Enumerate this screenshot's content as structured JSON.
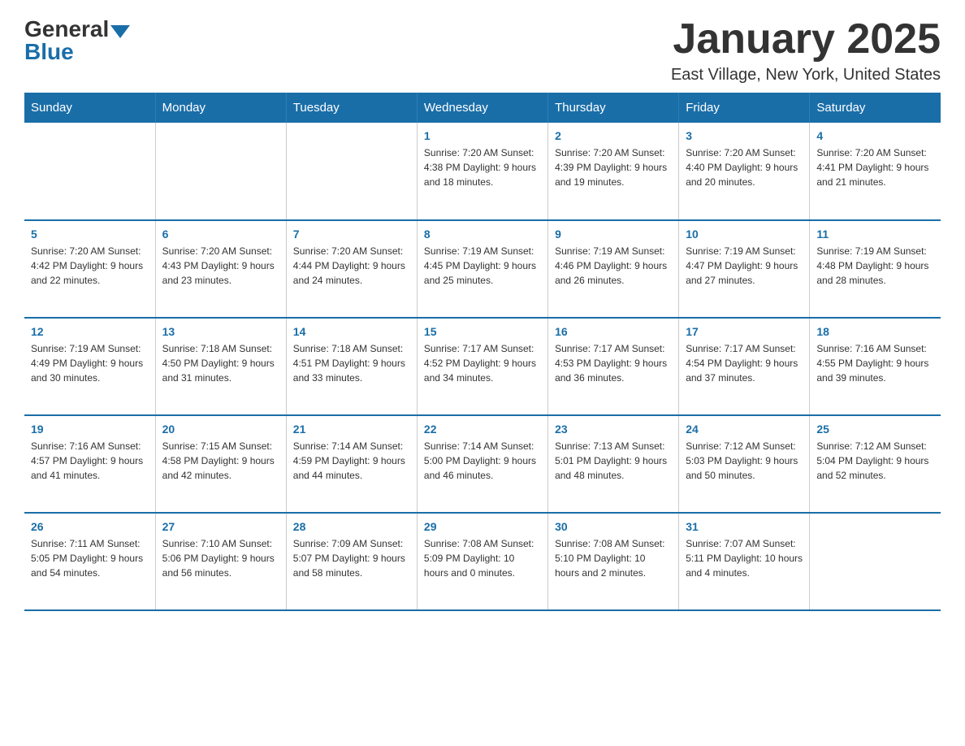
{
  "header": {
    "logo_general": "General",
    "logo_blue": "Blue",
    "month_title": "January 2025",
    "location": "East Village, New York, United States"
  },
  "weekdays": [
    "Sunday",
    "Monday",
    "Tuesday",
    "Wednesday",
    "Thursday",
    "Friday",
    "Saturday"
  ],
  "weeks": [
    [
      {
        "day": "",
        "info": ""
      },
      {
        "day": "",
        "info": ""
      },
      {
        "day": "",
        "info": ""
      },
      {
        "day": "1",
        "info": "Sunrise: 7:20 AM\nSunset: 4:38 PM\nDaylight: 9 hours\nand 18 minutes."
      },
      {
        "day": "2",
        "info": "Sunrise: 7:20 AM\nSunset: 4:39 PM\nDaylight: 9 hours\nand 19 minutes."
      },
      {
        "day": "3",
        "info": "Sunrise: 7:20 AM\nSunset: 4:40 PM\nDaylight: 9 hours\nand 20 minutes."
      },
      {
        "day": "4",
        "info": "Sunrise: 7:20 AM\nSunset: 4:41 PM\nDaylight: 9 hours\nand 21 minutes."
      }
    ],
    [
      {
        "day": "5",
        "info": "Sunrise: 7:20 AM\nSunset: 4:42 PM\nDaylight: 9 hours\nand 22 minutes."
      },
      {
        "day": "6",
        "info": "Sunrise: 7:20 AM\nSunset: 4:43 PM\nDaylight: 9 hours\nand 23 minutes."
      },
      {
        "day": "7",
        "info": "Sunrise: 7:20 AM\nSunset: 4:44 PM\nDaylight: 9 hours\nand 24 minutes."
      },
      {
        "day": "8",
        "info": "Sunrise: 7:19 AM\nSunset: 4:45 PM\nDaylight: 9 hours\nand 25 minutes."
      },
      {
        "day": "9",
        "info": "Sunrise: 7:19 AM\nSunset: 4:46 PM\nDaylight: 9 hours\nand 26 minutes."
      },
      {
        "day": "10",
        "info": "Sunrise: 7:19 AM\nSunset: 4:47 PM\nDaylight: 9 hours\nand 27 minutes."
      },
      {
        "day": "11",
        "info": "Sunrise: 7:19 AM\nSunset: 4:48 PM\nDaylight: 9 hours\nand 28 minutes."
      }
    ],
    [
      {
        "day": "12",
        "info": "Sunrise: 7:19 AM\nSunset: 4:49 PM\nDaylight: 9 hours\nand 30 minutes."
      },
      {
        "day": "13",
        "info": "Sunrise: 7:18 AM\nSunset: 4:50 PM\nDaylight: 9 hours\nand 31 minutes."
      },
      {
        "day": "14",
        "info": "Sunrise: 7:18 AM\nSunset: 4:51 PM\nDaylight: 9 hours\nand 33 minutes."
      },
      {
        "day": "15",
        "info": "Sunrise: 7:17 AM\nSunset: 4:52 PM\nDaylight: 9 hours\nand 34 minutes."
      },
      {
        "day": "16",
        "info": "Sunrise: 7:17 AM\nSunset: 4:53 PM\nDaylight: 9 hours\nand 36 minutes."
      },
      {
        "day": "17",
        "info": "Sunrise: 7:17 AM\nSunset: 4:54 PM\nDaylight: 9 hours\nand 37 minutes."
      },
      {
        "day": "18",
        "info": "Sunrise: 7:16 AM\nSunset: 4:55 PM\nDaylight: 9 hours\nand 39 minutes."
      }
    ],
    [
      {
        "day": "19",
        "info": "Sunrise: 7:16 AM\nSunset: 4:57 PM\nDaylight: 9 hours\nand 41 minutes."
      },
      {
        "day": "20",
        "info": "Sunrise: 7:15 AM\nSunset: 4:58 PM\nDaylight: 9 hours\nand 42 minutes."
      },
      {
        "day": "21",
        "info": "Sunrise: 7:14 AM\nSunset: 4:59 PM\nDaylight: 9 hours\nand 44 minutes."
      },
      {
        "day": "22",
        "info": "Sunrise: 7:14 AM\nSunset: 5:00 PM\nDaylight: 9 hours\nand 46 minutes."
      },
      {
        "day": "23",
        "info": "Sunrise: 7:13 AM\nSunset: 5:01 PM\nDaylight: 9 hours\nand 48 minutes."
      },
      {
        "day": "24",
        "info": "Sunrise: 7:12 AM\nSunset: 5:03 PM\nDaylight: 9 hours\nand 50 minutes."
      },
      {
        "day": "25",
        "info": "Sunrise: 7:12 AM\nSunset: 5:04 PM\nDaylight: 9 hours\nand 52 minutes."
      }
    ],
    [
      {
        "day": "26",
        "info": "Sunrise: 7:11 AM\nSunset: 5:05 PM\nDaylight: 9 hours\nand 54 minutes."
      },
      {
        "day": "27",
        "info": "Sunrise: 7:10 AM\nSunset: 5:06 PM\nDaylight: 9 hours\nand 56 minutes."
      },
      {
        "day": "28",
        "info": "Sunrise: 7:09 AM\nSunset: 5:07 PM\nDaylight: 9 hours\nand 58 minutes."
      },
      {
        "day": "29",
        "info": "Sunrise: 7:08 AM\nSunset: 5:09 PM\nDaylight: 10 hours\nand 0 minutes."
      },
      {
        "day": "30",
        "info": "Sunrise: 7:08 AM\nSunset: 5:10 PM\nDaylight: 10 hours\nand 2 minutes."
      },
      {
        "day": "31",
        "info": "Sunrise: 7:07 AM\nSunset: 5:11 PM\nDaylight: 10 hours\nand 4 minutes."
      },
      {
        "day": "",
        "info": ""
      }
    ]
  ]
}
